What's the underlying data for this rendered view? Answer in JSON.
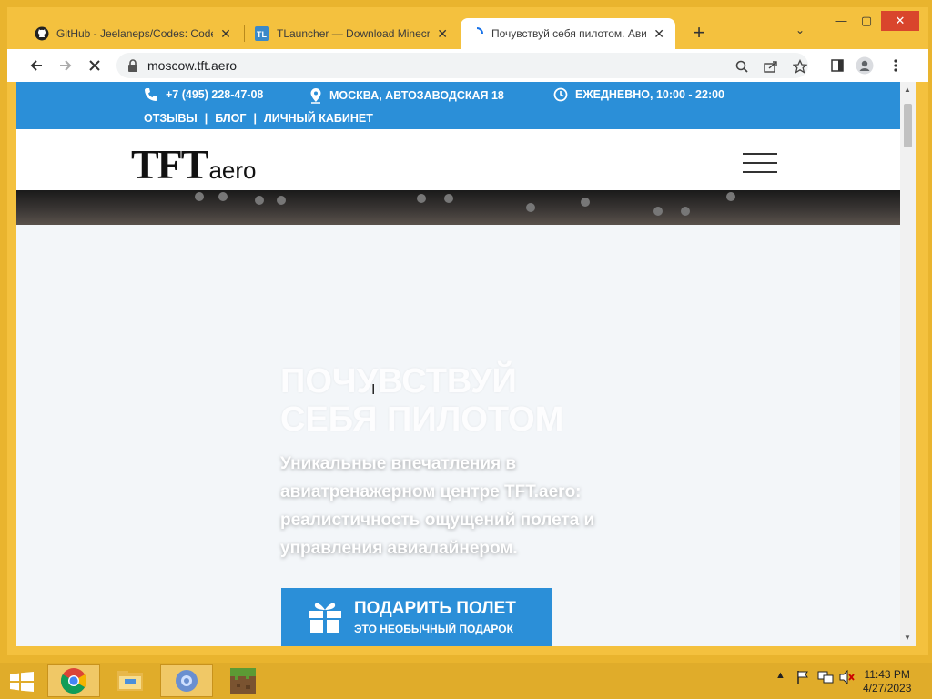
{
  "browser": {
    "tabs": [
      {
        "title": "GitHub - Jeelaneps/Codes: Code",
        "icon": "github-icon"
      },
      {
        "title": "TLauncher — Download Minecra",
        "icon": "tlauncher-icon"
      },
      {
        "title": "Почувствуй себя пилотом. Авиа",
        "icon": "loading-spinner-icon"
      }
    ],
    "new_tab_label": "+",
    "url": "moscow.tft.aero"
  },
  "site": {
    "phone": "+7 (495) 228-47-08",
    "address": "МОСКВА, АВТОЗАВОДСКАЯ 18",
    "hours": "ЕЖЕДНЕВНО, 10:00 - 22:00",
    "links": [
      "ОТЗЫВЫ",
      "БЛОГ",
      "ЛИЧНЫЙ КАБИНЕТ"
    ],
    "link_separator": "|",
    "logo_main": "TFT",
    "logo_suffix": "aero",
    "hero_title_line1": "ПОЧУВСТВУЙ",
    "hero_title_line2": "СЕБЯ ПИЛОТОМ",
    "hero_text": "Уникальные впечатления в авиатренажерном центре TFT.aero: реалистичность ощущений полета и управления авиалайнером.",
    "gift_button_main": "ПОДАРИТЬ ПОЛЕТ",
    "gift_button_sub": "ЭТО НЕОБЫЧНЫЙ ПОДАРОК",
    "accent_color": "#2b8fd8"
  },
  "taskbar": {
    "apps": [
      "chrome-icon",
      "file-explorer-icon",
      "settings-gear-icon",
      "minecraft-icon"
    ],
    "time": "11:43 PM",
    "date": "4/27/2023"
  }
}
